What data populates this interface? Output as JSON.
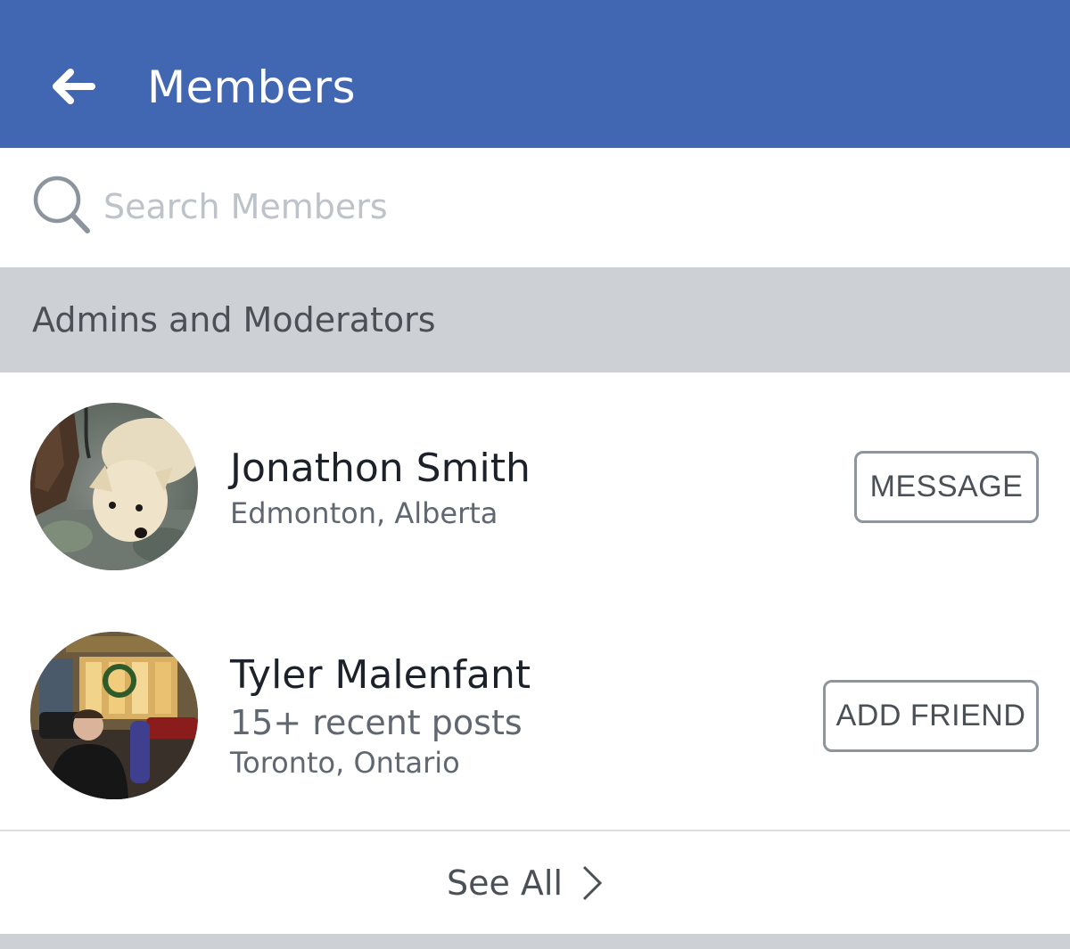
{
  "header": {
    "title": "Members",
    "back_icon": "arrow-left-icon",
    "background": "#4267b2"
  },
  "search": {
    "placeholder": "Search Members",
    "value": "",
    "icon": "search-icon"
  },
  "section": {
    "title": "Admins and Moderators"
  },
  "members": [
    {
      "name": "Jonathon Smith",
      "subtitle_lines": [
        "Edmonton, Alberta"
      ],
      "action_label": "MESSAGE",
      "avatar": "dog-photo"
    },
    {
      "name": "Tyler Malenfant",
      "subtitle_lines": [
        "15+ recent posts",
        "Toronto, Ontario"
      ],
      "action_label": "ADD FRIEND",
      "avatar": "person-photo"
    }
  ],
  "footer": {
    "see_all_label": "See All",
    "see_all_icon": "chevron-right-icon"
  },
  "colors": {
    "brand_blue": "#4267b2",
    "section_gray": "#cdd0d5",
    "placeholder_gray": "#bec2c9",
    "button_border": "#90949c"
  }
}
